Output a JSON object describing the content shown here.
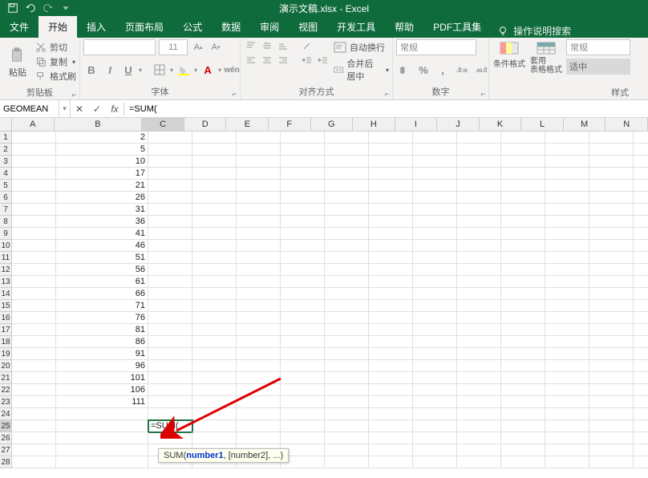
{
  "title": "演示文稿.xlsx - Excel",
  "tabs": [
    "文件",
    "开始",
    "插入",
    "页面布局",
    "公式",
    "数据",
    "审阅",
    "视图",
    "开发工具",
    "帮助",
    "PDF工具集"
  ],
  "active_tab": 1,
  "tell_me": "操作说明搜索",
  "clipboard": {
    "paste": "粘贴",
    "cut": "剪切",
    "copy": "复制",
    "painter": "格式刷",
    "label": "剪贴板"
  },
  "font": {
    "name": "",
    "size": "11",
    "label": "字体",
    "buttons": [
      "B",
      "I",
      "U"
    ]
  },
  "align": {
    "wrap": "自动换行",
    "merge": "合并后居中",
    "label": "对齐方式"
  },
  "number": {
    "format": "常规",
    "label": "数字"
  },
  "styles": {
    "cond": "条件格式",
    "table": "套用\n表格格式",
    "cell_fmt": "常规",
    "cell_sel": "适中",
    "label": "样式"
  },
  "name_box": "GEOMEAN",
  "formula": "=SUM(",
  "columns": [
    "A",
    "B",
    "C",
    "D",
    "E",
    "F",
    "G",
    "H",
    "I",
    "J",
    "K",
    "L",
    "M",
    "N"
  ],
  "rows": 28,
  "active_cell": {
    "row": 25,
    "col": 2,
    "text": "=SUM("
  },
  "sel_col": 2,
  "sel_row": 25,
  "data_b": [
    2,
    5,
    10,
    17,
    21,
    26,
    31,
    36,
    41,
    46,
    51,
    56,
    61,
    66,
    71,
    76,
    81,
    86,
    91,
    96,
    101,
    106,
    111
  ],
  "tooltip": {
    "fn": "SUM",
    "arg1": "number1",
    "rest": ", [number2], ...)"
  },
  "chart_data": null
}
